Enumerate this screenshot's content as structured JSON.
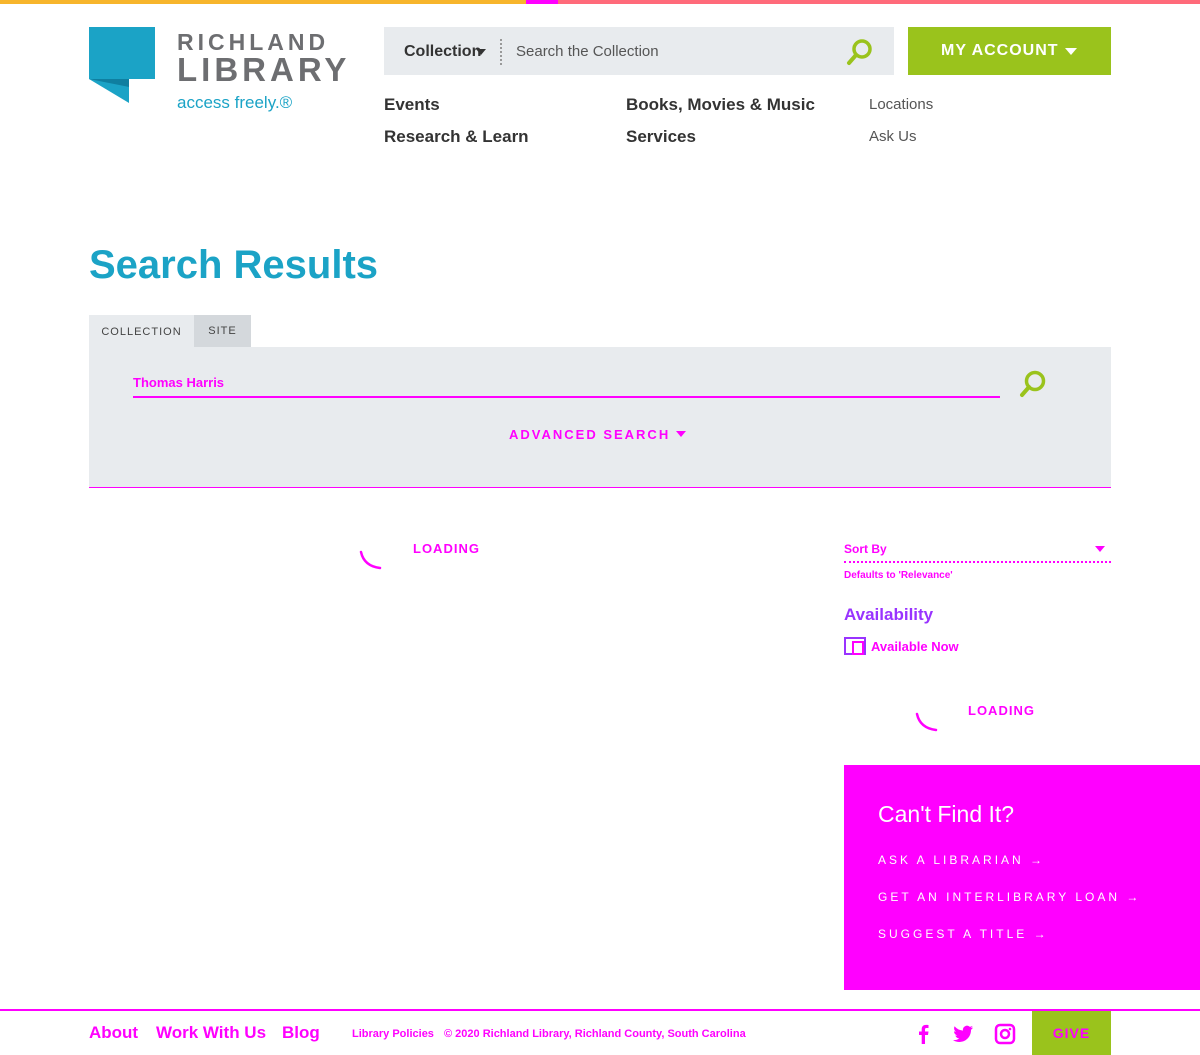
{
  "brand": {
    "name_line1": "RICHLAND",
    "name_line2": "LIBRARY",
    "tagline": "access freely.®"
  },
  "header": {
    "search_scope": "Collection",
    "search_placeholder": "Search the Collection",
    "account_label": "MY ACCOUNT"
  },
  "nav": {
    "items": [
      {
        "label": "Events"
      },
      {
        "label": "Research & Learn"
      },
      {
        "label": "Books, Movies & Music"
      },
      {
        "label": "Services"
      },
      {
        "label": "Locations"
      },
      {
        "label": "Ask Us"
      }
    ]
  },
  "page": {
    "title": "Search Results",
    "tabs": [
      {
        "label": "COLLECTION",
        "active": true
      },
      {
        "label": "SITE",
        "active": false
      }
    ],
    "query": "Thomas Harris",
    "advanced_search": "ADVANCED SEARCH",
    "results_loading": "LOADING"
  },
  "sidebar": {
    "sort_label": "Sort By",
    "sort_hint": "Defaults to 'Relevance'",
    "availability_heading": "Availability",
    "availability_option": "Available Now",
    "facets_loading": "LOADING"
  },
  "cant_find": {
    "heading": "Can't Find It?",
    "links": [
      {
        "label": "ASK A LIBRARIAN →"
      },
      {
        "label": "GET AN INTERLIBRARY LOAN →"
      },
      {
        "label": "SUGGEST A TITLE →"
      }
    ]
  },
  "footer": {
    "links": [
      {
        "label": "About"
      },
      {
        "label": "Work With Us"
      },
      {
        "label": "Blog"
      }
    ],
    "policies": "Library Policies",
    "copyright": "© 2020 Richland Library, Richland County, South Carolina",
    "give_label": "GIVE",
    "social_icons": [
      "facebook-icon",
      "twitter-icon",
      "instagram-icon"
    ]
  },
  "colors": {
    "brand_blue": "#1ba3c6",
    "brand_green": "#9ac31c",
    "accent_magenta": "#ff00ff",
    "panel_gray": "#e8ebee"
  }
}
